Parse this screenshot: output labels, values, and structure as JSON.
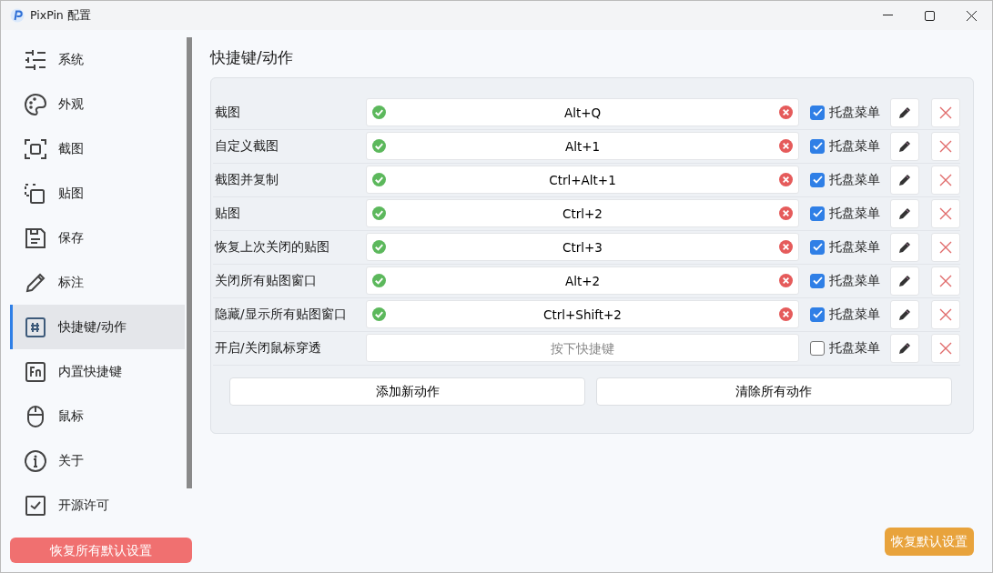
{
  "window": {
    "title": "PixPin 配置"
  },
  "sidebar": {
    "items": [
      {
        "label": "系统",
        "selected": false
      },
      {
        "label": "外观",
        "selected": false
      },
      {
        "label": "截图",
        "selected": false
      },
      {
        "label": "贴图",
        "selected": false
      },
      {
        "label": "保存",
        "selected": false
      },
      {
        "label": "标注",
        "selected": false
      },
      {
        "label": "快捷键/动作",
        "selected": true
      },
      {
        "label": "内置快捷键",
        "selected": false
      },
      {
        "label": "鼠标",
        "selected": false
      },
      {
        "label": "关于",
        "selected": false
      },
      {
        "label": "开源许可",
        "selected": false
      }
    ],
    "reset_all_button": "恢复所有默认设置"
  },
  "page": {
    "heading": "快捷键/动作",
    "actions": [
      {
        "label": "截图",
        "value": "Alt+Q",
        "valid": true,
        "tray_menu": true,
        "tray_label": "托盘菜单"
      },
      {
        "label": "自定义截图",
        "value": "Alt+1",
        "valid": true,
        "tray_menu": true,
        "tray_label": "托盘菜单"
      },
      {
        "label": "截图并复制",
        "value": "Ctrl+Alt+1",
        "valid": true,
        "tray_menu": true,
        "tray_label": "托盘菜单"
      },
      {
        "label": "贴图",
        "value": "Ctrl+2",
        "valid": true,
        "tray_menu": true,
        "tray_label": "托盘菜单"
      },
      {
        "label": "恢复上次关闭的贴图",
        "value": "Ctrl+3",
        "valid": true,
        "tray_menu": true,
        "tray_label": "托盘菜单"
      },
      {
        "label": "关闭所有贴图窗口",
        "value": "Alt+2",
        "valid": true,
        "tray_menu": true,
        "tray_label": "托盘菜单"
      },
      {
        "label": "隐藏/显示所有贴图窗口",
        "value": "Ctrl+Shift+2",
        "valid": true,
        "tray_menu": true,
        "tray_label": "托盘菜单"
      },
      {
        "label": "开启/关闭鼠标穿透",
        "placeholder": "按下快捷键",
        "valid": false,
        "tray_menu": false,
        "tray_label": "托盘菜单"
      }
    ],
    "add_button": "添加新动作",
    "clear_button": "清除所有动作",
    "reset_button": "恢复默认设置"
  }
}
